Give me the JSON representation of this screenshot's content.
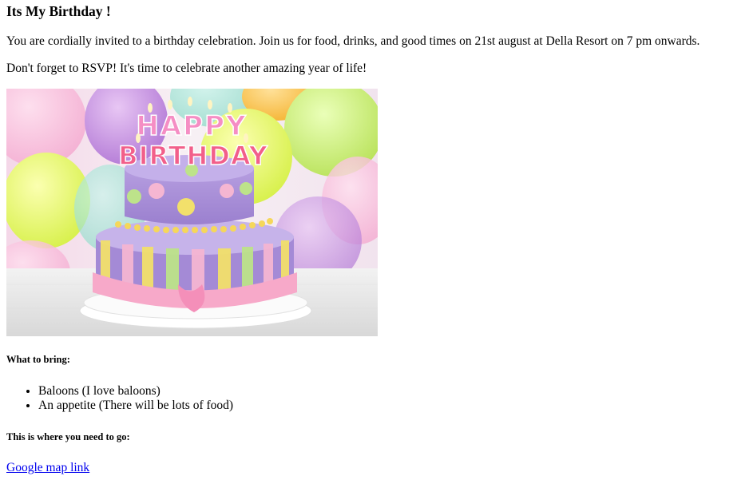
{
  "heading": "Its My Birthday !",
  "intro": "You are cordially invited to a birthday celebration. Join us for food, drinks, and good times on 21st august at Della Resort on 7 pm onwards.",
  "rsvp": "Don't forget to RSVP! It's time to celebrate another amazing year of life!",
  "image": {
    "cake_text_top": "HAPPY",
    "cake_text_bottom": "BIRTHDAY"
  },
  "bring": {
    "heading": "What to bring:",
    "items": [
      "Baloons (I love baloons)",
      "An appetite (There will be lots of food)"
    ]
  },
  "location": {
    "heading": "This is where you need to go:",
    "link_text": "Google map link"
  },
  "colors": {
    "link": "#0000ee",
    "text": "#000000",
    "background": "#ffffff"
  }
}
